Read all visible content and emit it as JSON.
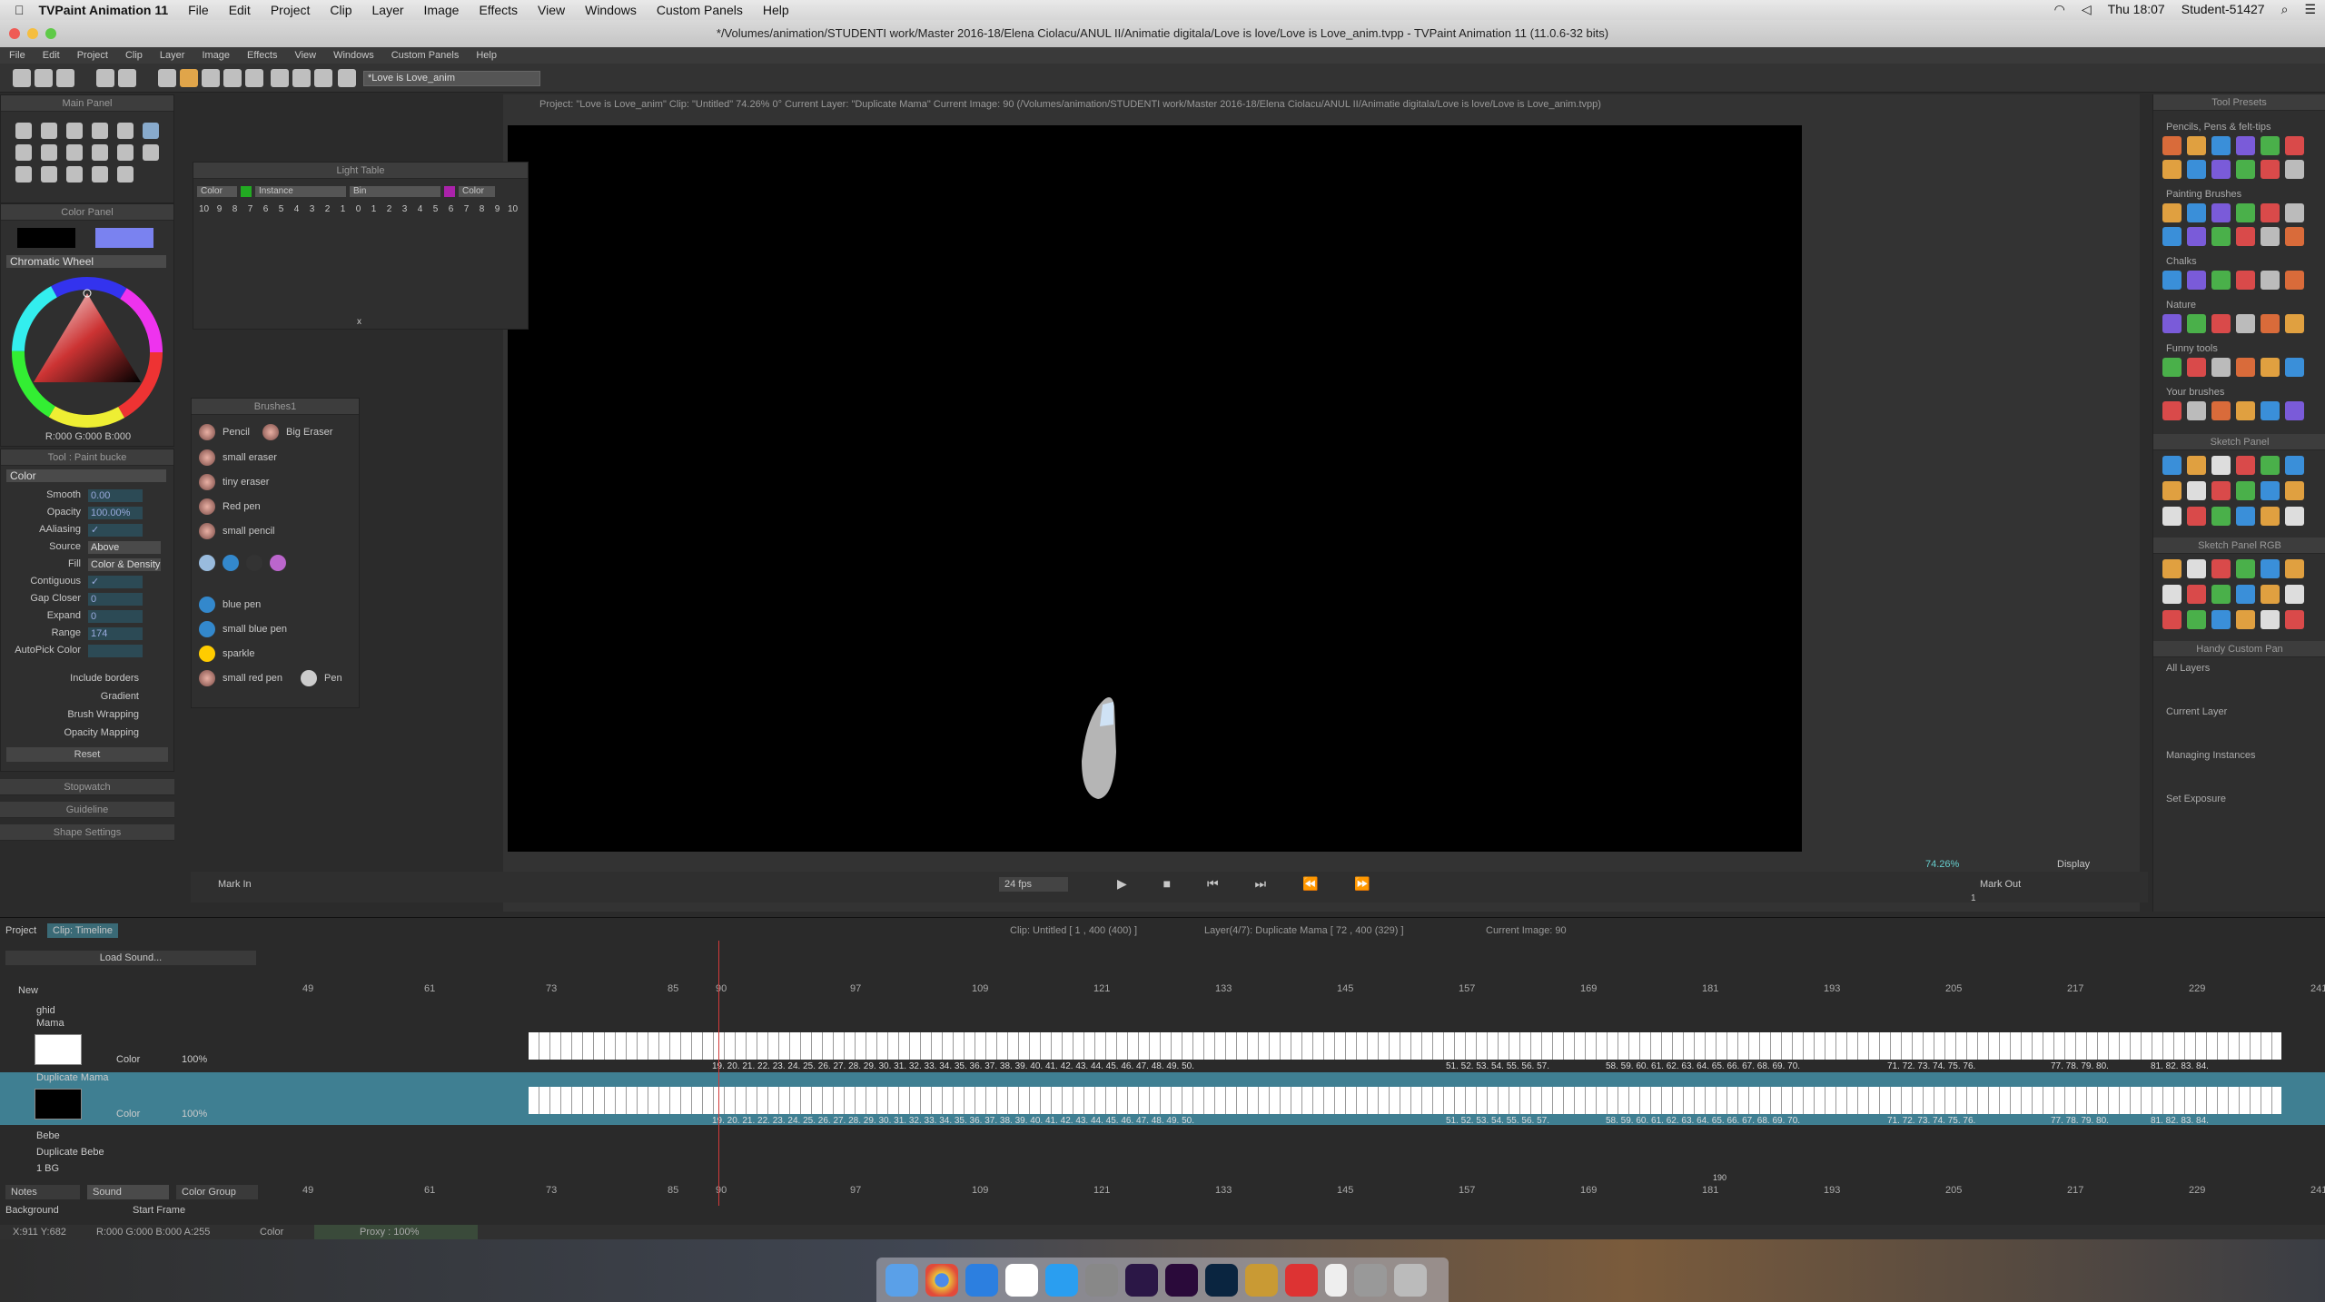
{
  "macmenu": {
    "app": "TVPaint Animation 11",
    "items": [
      "File",
      "Edit",
      "Project",
      "Clip",
      "Layer",
      "Image",
      "Effects",
      "View",
      "Windows",
      "Custom Panels",
      "Help"
    ],
    "clock": "Thu 18:07",
    "user": "Student-51427"
  },
  "window": {
    "title": "*/Volumes/animation/STUDENTI work/Master 2016-18/Elena Ciolacu/ANUL II/Animatie digitala/Love is love/Love is Love_anim.tvpp - TVPaint Animation 11 (11.0.6-32 bits)"
  },
  "appmenu": [
    "File",
    "Edit",
    "Project",
    "Clip",
    "Layer",
    "Image",
    "Effects",
    "View",
    "Windows",
    "Custom Panels",
    "Help"
  ],
  "toolbar": {
    "clip_field": "*Love is Love_anim"
  },
  "infobar": "Project: \"Love is Love_anim\"  Clip: \"Untitled\"  74.26%  0°  Current Layer: \"Duplicate Mama\"  Current Image: 90 (/Volumes/animation/STUDENTI work/Master 2016-18/Elena Ciolacu/ANUL II/Animatie digitala/Love is love/Love is Love_anim.tvpp)",
  "main_panel": {
    "title": "Main Panel"
  },
  "color_panel": {
    "title": "Color Panel",
    "mode": "Chromatic Wheel",
    "rgb_readout": "R:000 G:000 B:000",
    "swatch_a": "#000000",
    "swatch_b": "#7a82f0"
  },
  "tool_panel": {
    "title": "Tool : Paint bucke",
    "mode": "Color",
    "rows": [
      {
        "label": "Smooth",
        "value": "0.00"
      },
      {
        "label": "Opacity",
        "value": "100.00%"
      },
      {
        "label": "AAliasing",
        "value": "✓"
      },
      {
        "label": "Source",
        "value": "Above"
      },
      {
        "label": "Fill",
        "value": "Color & Density"
      },
      {
        "label": "Contiguous",
        "value": "✓"
      },
      {
        "label": "Gap Closer",
        "value": "0"
      },
      {
        "label": "Expand",
        "value": "0"
      },
      {
        "label": "Range",
        "value": "174"
      },
      {
        "label": "AutoPick Color",
        "value": ""
      }
    ],
    "checks": [
      "Include borders",
      "Gradient",
      "Brush Wrapping",
      "Opacity Mapping"
    ],
    "reset": "Reset",
    "collapsed": [
      "Stopwatch",
      "Guideline",
      "Shape Settings"
    ]
  },
  "light_table": {
    "title": "Light Table",
    "headers": [
      "Color",
      "Instance",
      "Bin",
      "Color"
    ],
    "left_nums": [
      "10",
      "9",
      "8",
      "7",
      "6",
      "5",
      "4",
      "3",
      "2",
      "1"
    ],
    "center": "0",
    "right_nums": [
      "1",
      "2",
      "3",
      "4",
      "5",
      "6",
      "7",
      "8",
      "9",
      "10"
    ],
    "x": "x"
  },
  "brushes": {
    "title": "Brushes1",
    "items": [
      "Pencil",
      "Big Eraser",
      "small eraser",
      "tiny eraser",
      "Red pen",
      "small pencil",
      "blue pen",
      "small blue pen",
      "sparkle",
      "small red pen",
      "Pen"
    ]
  },
  "presets": {
    "title": "Tool Presets",
    "sections": [
      "Pencils, Pens & felt-tips",
      "Painting Brushes",
      "Chalks",
      "Nature",
      "Funny tools",
      "Your brushes"
    ],
    "sketch": "Sketch Panel",
    "sketch_rgb": "Sketch Panel RGB",
    "handy": "Handy Custom Pan",
    "handy_items": [
      "All Layers",
      "Current Layer",
      "Managing Instances",
      "Set Exposure"
    ]
  },
  "playback": {
    "mark_in": "Mark In",
    "mark_out": "Mark Out",
    "fps": "24 fps",
    "zoom": "74.26%",
    "display": "Display",
    "start": "1"
  },
  "timeline": {
    "tabs": [
      "Project",
      "Clip: Timeline"
    ],
    "info_clip": "Clip: Untitled [ 1 , 400  (400) ]",
    "info_layer": "Layer(4/7): Duplicate Mama [ 72 , 400  (329) ]",
    "info_image": "Current Image: 90",
    "load_sound": "Load Sound...",
    "new": "New",
    "ruler": [
      "49",
      "61",
      "73",
      "85",
      "90",
      "97",
      "109",
      "121",
      "133",
      "145",
      "157",
      "169",
      "181",
      "193",
      "205",
      "217",
      "229",
      "241"
    ],
    "layers": [
      {
        "name": "ghid"
      },
      {
        "name": "Mama",
        "mode": "Color",
        "opacity": "100%"
      },
      {
        "name": "Duplicate Mama",
        "mode": "Color",
        "opacity": "100%"
      },
      {
        "name": "Bebe"
      },
      {
        "name": "Duplicate Bebe"
      },
      {
        "name": "1 BG"
      }
    ],
    "frame_nums": "19. 20. 21. 22. 23. 24. 25. 26. 27. 28. 29. 30. 31. 32. 33. 34. 35. 36. 37. 38. 39. 40. 41. 42. 43. 44. 45. 46. 47. 48. 49. 50.",
    "frame_nums2": "51. 52. 53. 54. 55. 56. 57.",
    "frame_nums3": "58. 59. 60. 61. 62. 63. 64. 65. 66. 67. 68. 69. 70.",
    "frame_nums4": "71. 72. 73. 74. 75. 76.",
    "frame_nums5": "77. 78. 79. 80.",
    "frame_nums6": "81. 82. 83. 84.",
    "bottom_tabs": [
      "Notes",
      "Sound",
      "Color Group"
    ],
    "bg": "Background",
    "start_frame": "Start Frame",
    "end_marker": "190"
  },
  "status": {
    "coords": "X:911  Y:682",
    "rgba": "R:000 G:000 B:000 A:255",
    "mode": "Color",
    "proxy": "Proxy : 100%"
  },
  "colors": {
    "accent": "#3f9bb3",
    "playhead": "#d23a3a"
  }
}
